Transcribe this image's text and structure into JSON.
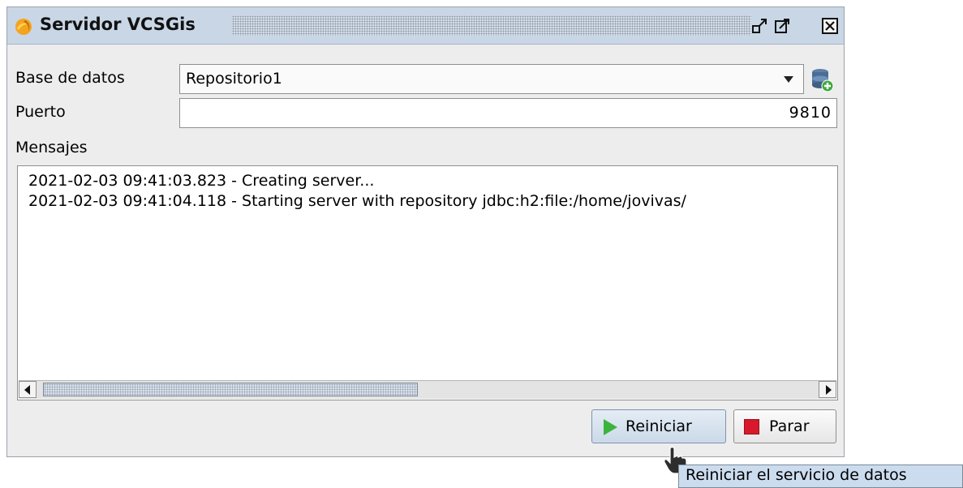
{
  "window": {
    "title": "Servidor VCSGis",
    "icons": {
      "app": "app-logo-icon",
      "restore": "restore-window-icon",
      "maximize": "maximize-window-icon",
      "close": "close-window-icon"
    }
  },
  "form": {
    "database_label": "Base de datos",
    "database_value": "Repositorio1",
    "database_add_icon": "add-database-icon",
    "port_label": "Puerto",
    "port_value": "9810",
    "messages_label": "Mensajes"
  },
  "messages": [
    "2021-02-03 09:41:03.823 - Creating server...",
    "2021-02-03 09:41:04.118 - Starting server with repository jdbc:h2:file:/home/jovivas/"
  ],
  "buttons": {
    "restart_label": "Reiniciar",
    "restart_icon": "play-icon",
    "stop_label": "Parar",
    "stop_icon": "stop-icon"
  },
  "tooltip": "Reiniciar el servicio de datos",
  "colors": {
    "play": "#3db33d",
    "stop": "#d8192c",
    "titlebar": "#c9d6e6",
    "tooltip_bg": "#ccdcef"
  }
}
